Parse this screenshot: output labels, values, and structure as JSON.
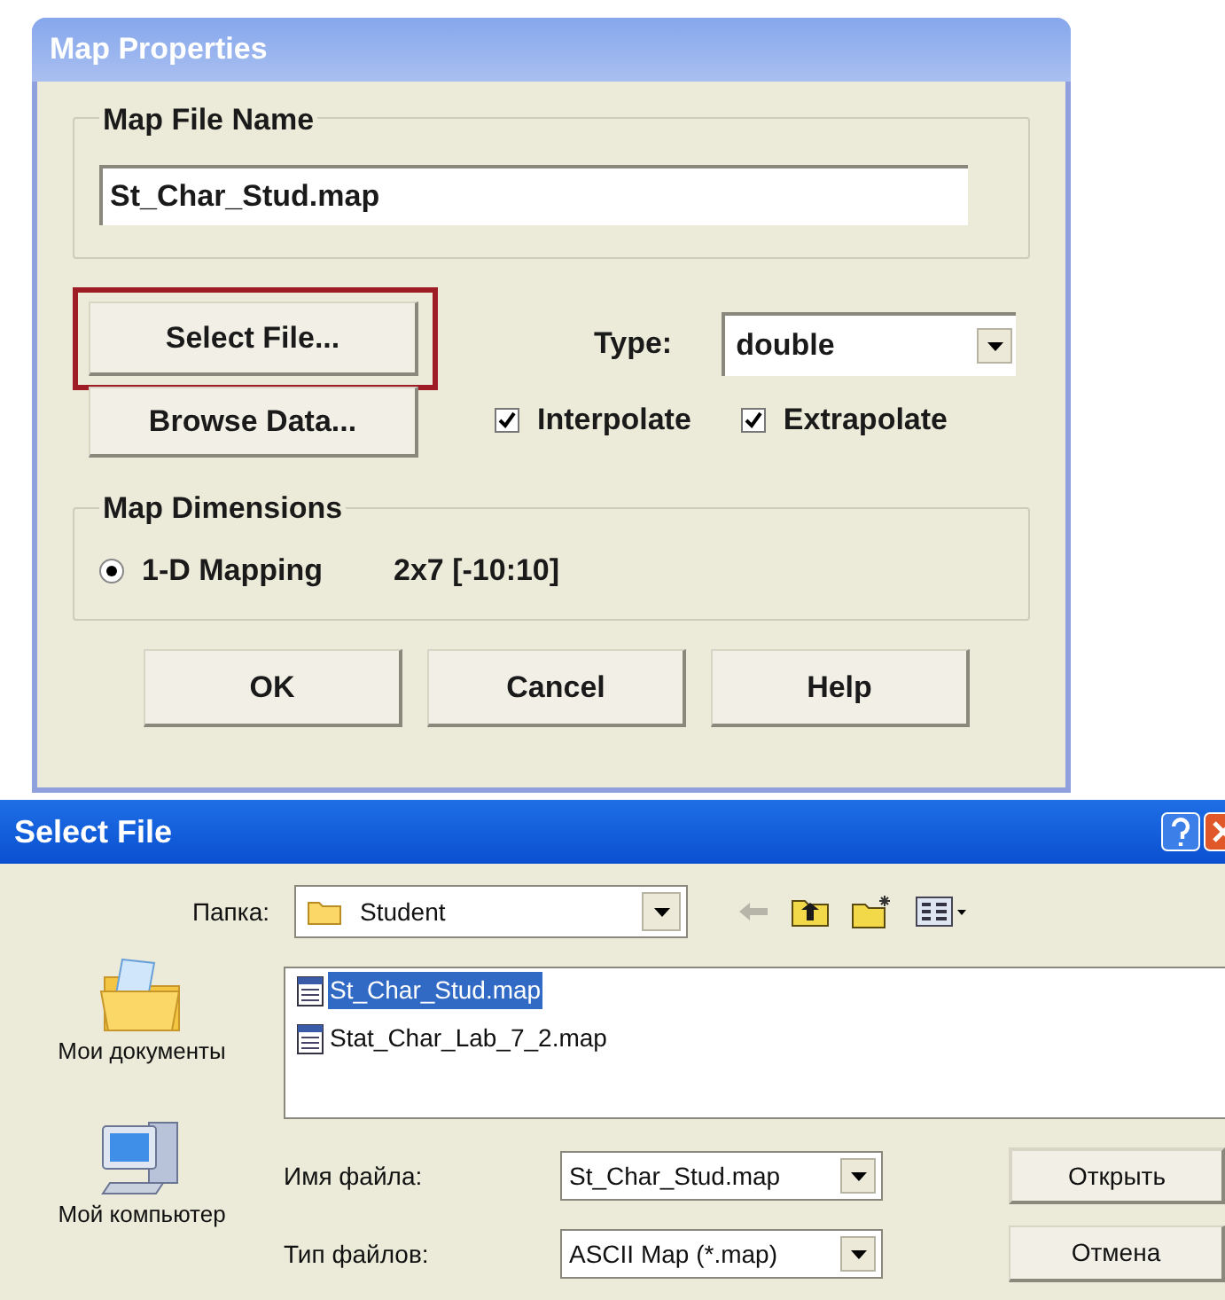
{
  "map_properties": {
    "title": "Map Properties",
    "file_group": {
      "label": "Map File Name",
      "value": "St_Char_Stud.map"
    },
    "select_button": {
      "label": "Select File...",
      "highlighted": true
    },
    "browse_button": {
      "label": "Browse Data..."
    },
    "type": {
      "label": "Type:",
      "value": "double"
    },
    "options": [
      {
        "label": "Interpolate",
        "checked": true
      },
      {
        "label": "Extrapolate",
        "checked": true
      }
    ],
    "dimensions": {
      "label": "Map Dimensions",
      "options": [
        {
          "label": "1-D Mapping",
          "selected": true
        }
      ],
      "info": "2x7 [-10:10]"
    },
    "buttons": [
      "OK",
      "Cancel",
      "Help"
    ]
  },
  "select_file": {
    "title": "Select File",
    "folder_label": "Папка:",
    "folder": "Student",
    "places": [
      {
        "kind": "documents",
        "label": "Мои документы"
      },
      {
        "kind": "computer",
        "label": "Мой компьютер"
      }
    ],
    "files": [
      {
        "name": "St_Char_Stud.map",
        "selected": true
      },
      {
        "name": "Stat_Char_Lab_7_2.map",
        "selected": false
      }
    ],
    "filename_label": "Имя файла:",
    "filename": "St_Char_Stud.map",
    "filetype_label": "Тип файлов:",
    "filetype": "ASCII Map (*.map)",
    "buttons": [
      "Открыть",
      "Отмена"
    ]
  }
}
